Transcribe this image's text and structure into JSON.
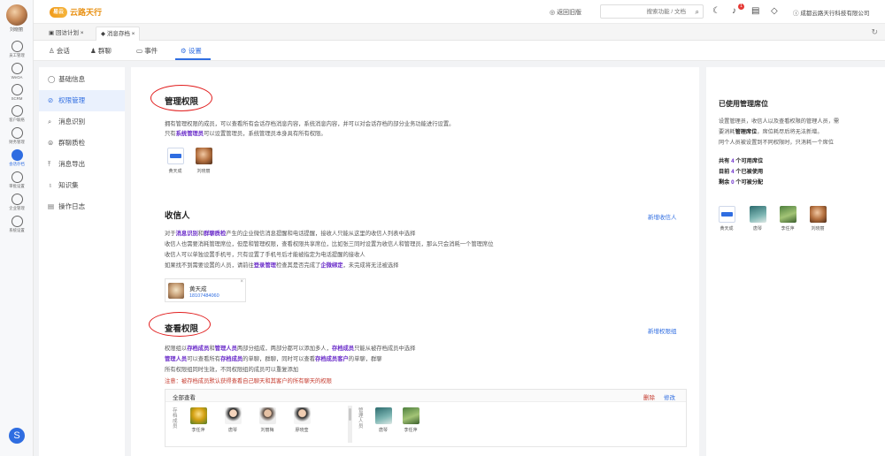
{
  "rail": {
    "user_name": "刘晓丽",
    "items": [
      "员工管理",
      "WeOA",
      "SCRM",
      "客户联络",
      "财务管理",
      "会话存档",
      "审批设置",
      "企业管理",
      "系统设置"
    ]
  },
  "topbar": {
    "logo_mark": "易云",
    "logo_text": "云路天行",
    "back_home": "返回旧版",
    "search_placeholder": "搜索功能 / 文档",
    "bell_count": "1",
    "company": "成都云路天行科技有限公司"
  },
  "window_tabs": [
    {
      "label": "回访计划"
    },
    {
      "label": "消息存档"
    }
  ],
  "sub_tabs": [
    {
      "label": "会话"
    },
    {
      "label": "群聊"
    },
    {
      "label": "事件"
    },
    {
      "label": "设置"
    }
  ],
  "side_menu": [
    {
      "label": "基础信息",
      "icon": "info-icon"
    },
    {
      "label": "权限管理",
      "icon": "shield-icon"
    },
    {
      "label": "消息识别",
      "icon": "search-icon"
    },
    {
      "label": "群聊质检",
      "icon": "group-icon"
    },
    {
      "label": "消息导出",
      "icon": "export-icon"
    },
    {
      "label": "知识集",
      "icon": "knowledge-icon"
    },
    {
      "label": "操作日志",
      "icon": "log-icon"
    }
  ],
  "admin": {
    "title": "管理权限",
    "line1": "拥有管理权限的成员，可以查看所有会话存档消息内容，系统消息内容，并可以对会话存档的部分业务功能进行设置。",
    "line2_pre": "只有",
    "line2_bold": "系统管理员",
    "line2_post": "可以设置管理员，系统管理员本身具有所有权限。",
    "members": [
      {
        "name": "黄天成"
      },
      {
        "name": "刘晓丽"
      }
    ]
  },
  "receiver": {
    "title": "收信人",
    "add_link": "新增收信人",
    "l1_pre": "对于",
    "l1_b1": "消息识别",
    "l1_mid": "和",
    "l1_b2": "群聊质检",
    "l1_post": "产生的企业微信消息提醒和电话提醒，接收人只能从这里的收信人列表中选择",
    "l2": "收信人也需要消耗管理席位，但是和管理权限，查看权限共享席位，比如张三同时设置为收信人和管理员，那么只会消耗一个管理席位",
    "l3": "收信人可以单独设置手机号，只有设置了手机号后才能被指定为电话提醒的接收人",
    "l4_pre": "如果找不到需要设置的人员，请前往",
    "l4_b1": "登录管理",
    "l4_mid": "检查其是否完成了",
    "l4_b2": "企微绑定",
    "l4_post": "，未完成将无法被选择",
    "card_name": "黄天成",
    "card_phone": "18107484060"
  },
  "view": {
    "title": "查看权限",
    "add_link": "新增权限组",
    "l1_pre": "权限组以",
    "l1_b1": "存档成员",
    "l1_mid": "和",
    "l1_b2": "管理人员",
    "l1_mid2": "两部分组成，两部分都可以添加多人，",
    "l1_b3": "存档成员",
    "l1_post": "只能从被存档成员中选择",
    "l2_b1": "管理人员",
    "l2_mid": "可以查看所有",
    "l2_b2": "存档成员",
    "l2_mid2": "的单聊，群聊，同时可以查看",
    "l2_b3": "存档成员客户",
    "l2_post": "的单聊，群聊",
    "l3": "所有权限组同时生效，不同权限组的成员可以重复添加",
    "l4": "注意：被存档成员默认获得查看自己聊天和其客户的所有聊天的权限",
    "group_name": "全部查看",
    "delete": "删除",
    "edit": "修改",
    "archive_label": "存档成员",
    "manager_label": "管理人员",
    "archive_members": [
      {
        "name": "李任萍"
      },
      {
        "name": "唐琴"
      },
      {
        "name": "刘丽梅"
      },
      {
        "name": "廖晓莹"
      }
    ],
    "managers": [
      {
        "name": "唐琴"
      },
      {
        "name": "李任萍"
      }
    ]
  },
  "right_panel": {
    "title": "已使用管理席位",
    "d1": "设置管理员，收信人以及查看权限的管理人员，需",
    "d2_pre": "要消耗",
    "d2_bold": "管理席位",
    "d2_post": "，席位耗尽后将无法新增。",
    "d3": "同个人员被设置到不同权限时，只消耗一个席位",
    "s1_pre": "共有",
    "s1_num": "4",
    "s1_post": "个可用席位",
    "s2_pre": "目前",
    "s2_num": "4",
    "s2_post": "个已被使用",
    "s3_pre": "剩余",
    "s3_num": "0",
    "s3_post": "个可被分配",
    "members": [
      {
        "name": "黄天成"
      },
      {
        "name": "唐琴"
      },
      {
        "name": "李任萍"
      },
      {
        "name": "刘晓丽"
      }
    ]
  },
  "colors": {
    "accent": "#2f6de1",
    "highlight": "#6a2cc9",
    "warning": "#c53a2d",
    "annotation": "#e11d1d"
  }
}
